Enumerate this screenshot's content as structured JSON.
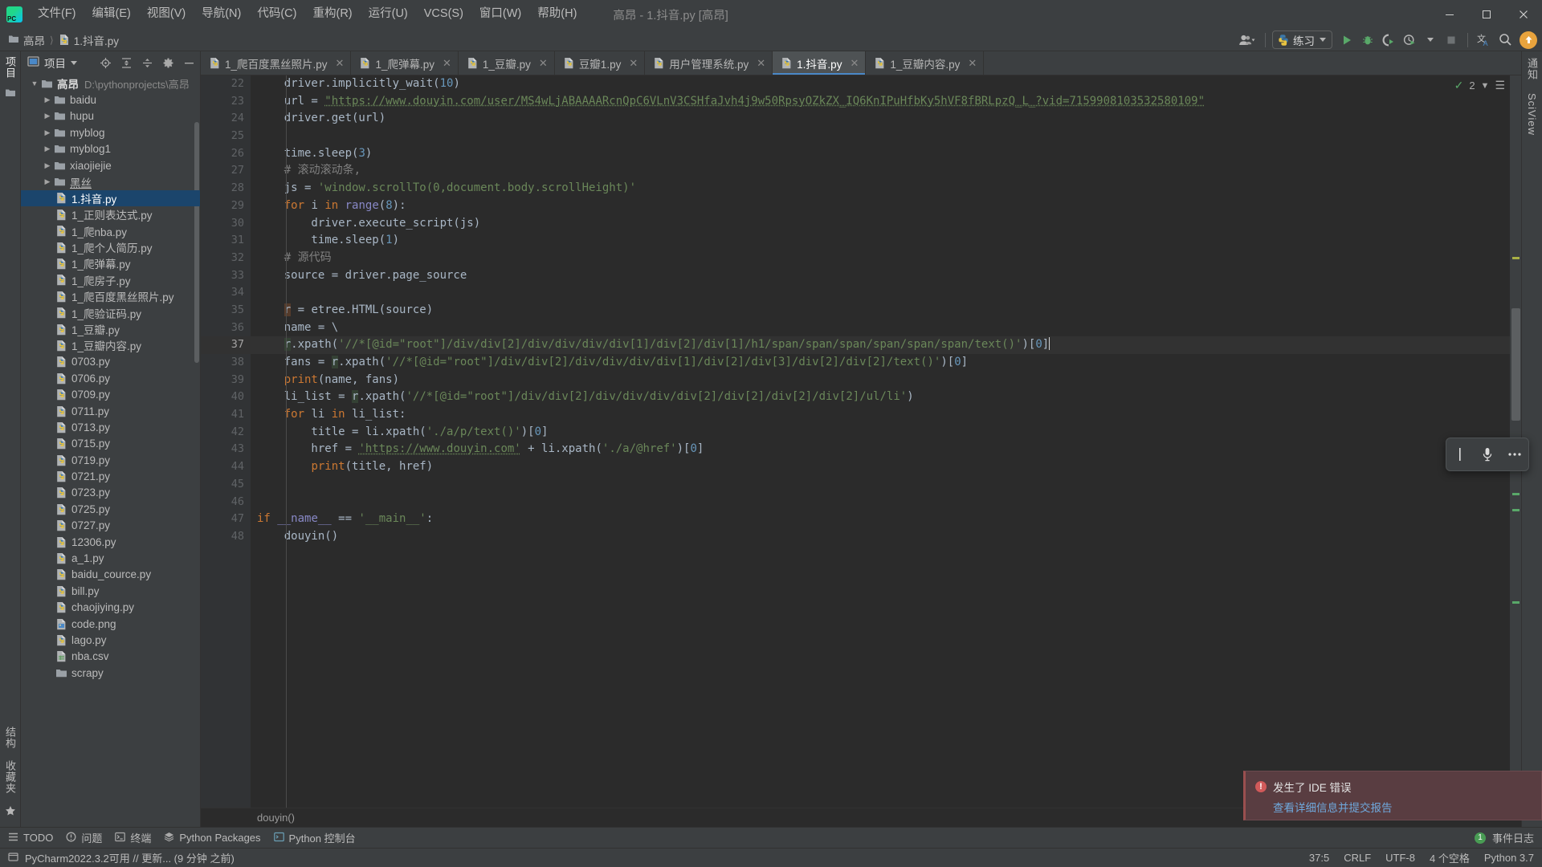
{
  "window": {
    "title": "高昂 - 1.抖音.py [高昂]",
    "menu": [
      "文件(F)",
      "编辑(E)",
      "视图(V)",
      "导航(N)",
      "代码(C)",
      "重构(R)",
      "运行(U)",
      "VCS(S)",
      "窗口(W)",
      "帮助(H)"
    ],
    "controls": {
      "minimize": "minimize-icon",
      "maximize": "maximize-icon",
      "close": "close-icon"
    }
  },
  "navbar": {
    "breadcrumbs": [
      "高昂",
      "1.抖音.py"
    ],
    "run_config": "练习",
    "icons": [
      "user-avatar-icon",
      "run-icon",
      "debug-icon",
      "coverage-icon",
      "profile-icon",
      "stop-icon",
      "translate-icon",
      "search-icon",
      "update-icon"
    ]
  },
  "left_strip": {
    "top": [
      "项目"
    ],
    "bottom": [
      "结构",
      "收藏夹"
    ]
  },
  "project": {
    "panel_title": "项目",
    "root": {
      "label": "高昂",
      "path": "D:\\pythonprojects\\高昂"
    },
    "folders": [
      "baidu",
      "hupu",
      "myblog",
      "myblog1",
      "xiaojiejie",
      "黑丝"
    ],
    "files": [
      "1.抖音.py",
      "1_正则表达式.py",
      "1_爬nba.py",
      "1_爬个人简历.py",
      "1_爬弹幕.py",
      "1_爬房子.py",
      "1_爬百度黑丝照片.py",
      "1_爬验证码.py",
      "1_豆瓣.py",
      "1_豆瓣内容.py",
      "0703.py",
      "0706.py",
      "0709.py",
      "0711.py",
      "0713.py",
      "0715.py",
      "0719.py",
      "0721.py",
      "0723.py",
      "0725.py",
      "0727.py",
      "12306.py",
      "a_1.py",
      "baidu_cource.py",
      "bill.py",
      "chaojiying.py",
      "code.png",
      "lago.py",
      "nba.csv",
      "scrapy"
    ],
    "selected": "1.抖音.py"
  },
  "tabs": [
    {
      "label": "1_爬百度黑丝照片.py",
      "active": false
    },
    {
      "label": "1_爬弹幕.py",
      "active": false
    },
    {
      "label": "1_豆瓣.py",
      "active": false
    },
    {
      "label": "豆瓣1.py",
      "active": false
    },
    {
      "label": "用户管理系统.py",
      "active": false
    },
    {
      "label": "1.抖音.py",
      "active": true
    },
    {
      "label": "1_豆瓣内容.py",
      "active": false
    }
  ],
  "editor": {
    "first_line": 22,
    "current_line": 37,
    "inspection_count": "2",
    "breadcrumb": "douyin()",
    "lines": [
      {
        "n": 22,
        "text": "    driver.implicitly_wait(10)"
      },
      {
        "n": 23,
        "text": "    url = \"https://www.douyin.com/user/MS4wLjABAAAARcnQpC6VLnV3CSHfaJvh4j9w50RpsyOZkZX_IQ6KnIPuHfbKy5hVF8fBRLpzQ_L_?vid=7159908103532580109\""
      },
      {
        "n": 24,
        "text": "    driver.get(url)"
      },
      {
        "n": 25,
        "text": ""
      },
      {
        "n": 26,
        "text": "    time.sleep(3)"
      },
      {
        "n": 27,
        "text": "    # 滚动滚动条,"
      },
      {
        "n": 28,
        "text": "    js = 'window.scrollTo(0,document.body.scrollHeight)'"
      },
      {
        "n": 29,
        "text": "    for i in range(8):"
      },
      {
        "n": 30,
        "text": "        driver.execute_script(js)"
      },
      {
        "n": 31,
        "text": "        time.sleep(1)"
      },
      {
        "n": 32,
        "text": "    # 源代码"
      },
      {
        "n": 33,
        "text": "    source = driver.page_source"
      },
      {
        "n": 34,
        "text": ""
      },
      {
        "n": 35,
        "text": "    r = etree.HTML(source)"
      },
      {
        "n": 36,
        "text": "    name = \\"
      },
      {
        "n": 37,
        "text": "    r.xpath('//*[@id=\"root\"]/div/div[2]/div/div/div/div[1]/div[2]/div[1]/h1/span/span/span/span/span/span/text()')[0]"
      },
      {
        "n": 38,
        "text": "    fans = r.xpath('//*[@id=\"root\"]/div/div[2]/div/div/div/div[1]/div[2]/div[3]/div[2]/div[2]/text()')[0]"
      },
      {
        "n": 39,
        "text": "    print(name, fans)"
      },
      {
        "n": 40,
        "text": "    li_list = r.xpath('//*[@id=\"root\"]/div/div[2]/div/div/div/div[2]/div[2]/div[2]/div[2]/ul/li')"
      },
      {
        "n": 41,
        "text": "    for li in li_list:"
      },
      {
        "n": 42,
        "text": "        title = li.xpath('./a/p/text()')[0]"
      },
      {
        "n": 43,
        "text": "        href = 'https://www.douyin.com' + li.xpath('./a/@href')[0]"
      },
      {
        "n": 44,
        "text": "        print(title, href)"
      },
      {
        "n": 45,
        "text": ""
      },
      {
        "n": 46,
        "text": ""
      },
      {
        "n": 47,
        "text": "if __name__ == '__main__':"
      },
      {
        "n": 48,
        "text": "    douyin()"
      }
    ]
  },
  "notification": {
    "title": "发生了 IDE 错误",
    "link": "查看详细信息并提交报告"
  },
  "tool_windows": {
    "items": [
      "TODO",
      "问题",
      "终端",
      "Python Packages",
      "Python 控制台"
    ],
    "right_item": "事件日志",
    "right_badge": "1"
  },
  "statusbar": {
    "message": "PyCharm2022.3.2可用 // 更新... (9 分钟 之前)",
    "caret": "37:5",
    "line_sep": "CRLF",
    "encoding": "UTF-8",
    "indent": "4 个空格",
    "interpreter": "Python 3.7"
  },
  "float_toolbar": {
    "icons": [
      "text-cursor-icon",
      "microphone-icon",
      "more-options-icon"
    ]
  },
  "colors": {
    "accent": "#4a88c7",
    "selection": "#1b456c",
    "error": "#9a4f4f",
    "run_green": "#59a869",
    "editor_bg": "#2b2b2b",
    "chrome_bg": "#3c3f41"
  }
}
